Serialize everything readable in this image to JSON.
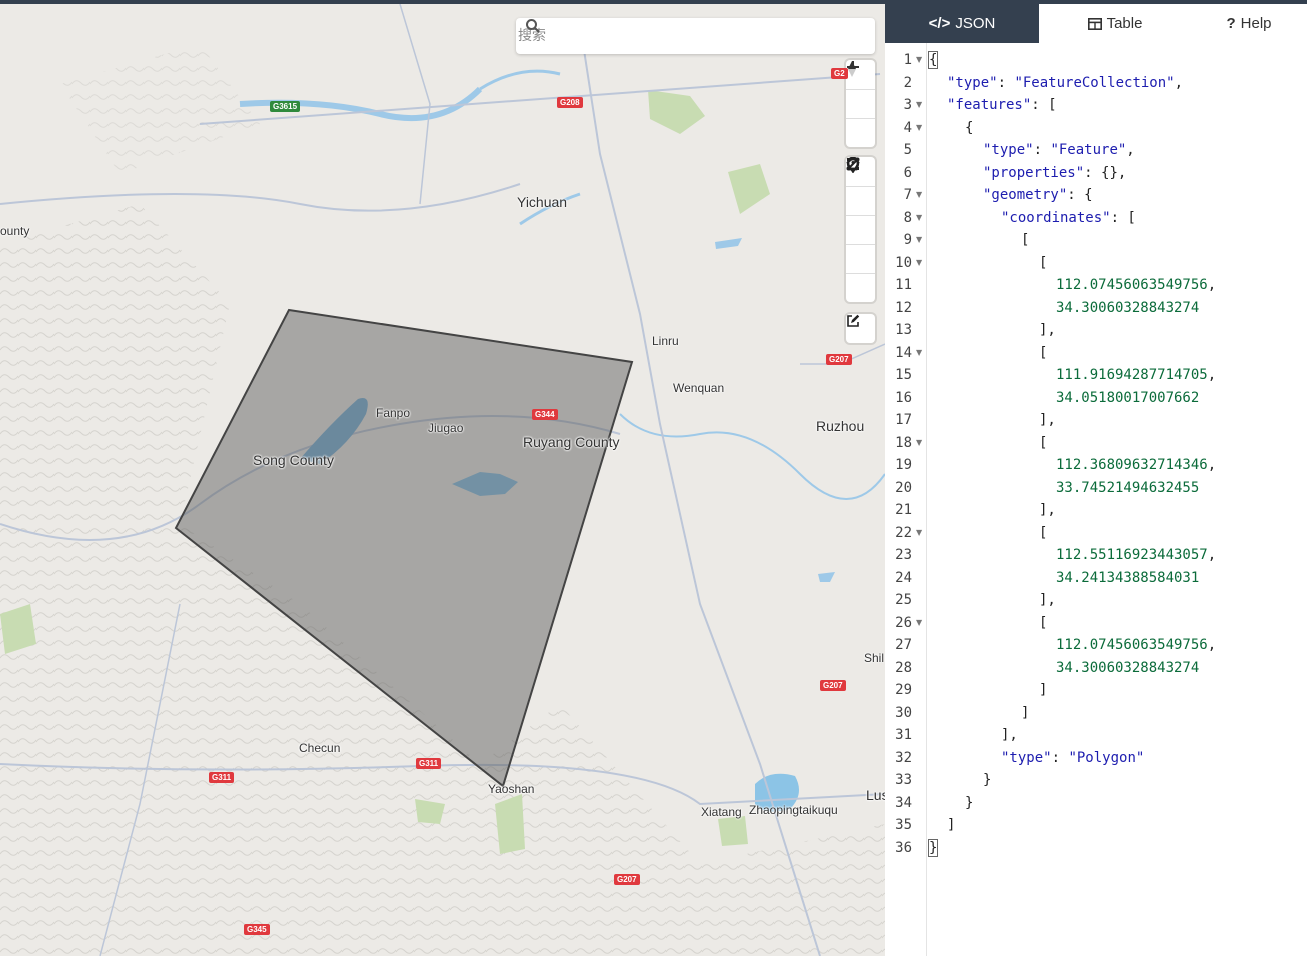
{
  "map": {
    "search_placeholder": "搜索",
    "labels": {
      "yichuan": "Yichuan",
      "county_left": "ounty",
      "linru": "Linru",
      "wenquan": "Wenquan",
      "ruzhou": "Ruzhou",
      "fanpo": "Fanpo",
      "jiugao": "Jiugao",
      "song_county": "Song County",
      "ruyang_county": "Ruyang County",
      "shil": "Shil",
      "checun": "Checun",
      "yaoshan": "Yaoshan",
      "xiatang": "Xiatang",
      "zhaopingtaikuqu": "Zhaopingtaikuqu",
      "lus": "Lus"
    },
    "shields": {
      "g3615": "G3615",
      "g208": "G208",
      "g2_top": "G2",
      "g207_a": "G207",
      "g344": "G344",
      "g207_b": "G207",
      "g311_a": "G311",
      "g311_b": "G311",
      "g207_c": "G207",
      "g345": "G345"
    },
    "polygon_fill": "#555555",
    "polygon_stroke": "#444444"
  },
  "panel": {
    "tabs": [
      {
        "label": "JSON",
        "icon": "</>",
        "active": true
      },
      {
        "label": "Table",
        "icon": "table-icon",
        "active": false
      },
      {
        "label": "Help",
        "icon": "?",
        "active": false
      }
    ],
    "line_numbers": [
      "1",
      "2",
      "3",
      "4",
      "5",
      "6",
      "7",
      "8",
      "9",
      "10",
      "11",
      "12",
      "13",
      "14",
      "15",
      "16",
      "17",
      "18",
      "19",
      "20",
      "21",
      "22",
      "23",
      "24",
      "25",
      "26",
      "27",
      "28",
      "29",
      "30",
      "31",
      "32",
      "33",
      "34",
      "35",
      "36"
    ],
    "tokens": {
      "type_key": "\"type\"",
      "fc": "\"FeatureCollection\"",
      "features_key": "\"features\"",
      "feature": "\"Feature\"",
      "properties_key": "\"properties\"",
      "geometry_key": "\"geometry\"",
      "coordinates_key": "\"coordinates\"",
      "polygon": "\"Polygon\"",
      "c1x": "112.07456063549756",
      "c1y": "34.30060328843274",
      "c2x": "111.91694287714705",
      "c2y": "34.05180017007662",
      "c3x": "112.36809632714346",
      "c3y": "33.74521494632455",
      "c4x": "112.55116923443057",
      "c4y": "34.24134388584031",
      "c5x": "112.07456063549756",
      "c5y": "34.30060328843274"
    },
    "accent": "#34404f"
  }
}
